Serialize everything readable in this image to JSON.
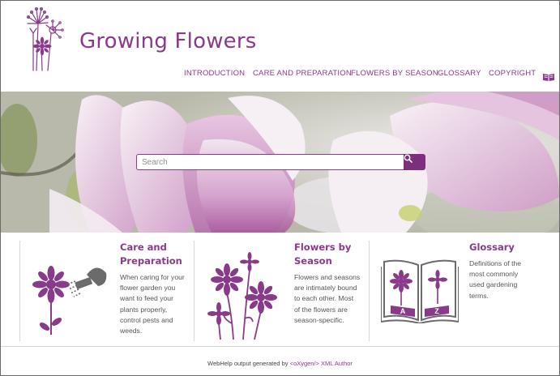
{
  "header": {
    "site_title": "Growing Flowers"
  },
  "nav": {
    "items": [
      {
        "label": "INTRODUCTION"
      },
      {
        "label": "CARE AND PREPARATION"
      },
      {
        "label": "FLOWERS BY SEASON"
      },
      {
        "label": "GLOSSARY"
      },
      {
        "label": "COPYRIGHT"
      }
    ],
    "extra_icon": "book-icon"
  },
  "search": {
    "placeholder": "Search",
    "button_icon": "search-icon"
  },
  "tiles": [
    {
      "title_line1": "Care and",
      "title_line2": "Preparation",
      "text_lines": [
        "When caring for your",
        "flower garden you",
        "want to feed your",
        "plants properly,",
        "control pests and",
        "weeds."
      ],
      "icon": "watering-flower-icon"
    },
    {
      "title_line1": "Flowers by",
      "title_line2": "Season",
      "text_lines": [
        "Flowers and seasons",
        "are intimately bound",
        "to each other. Most",
        "of the flowers are",
        "season-specific."
      ],
      "icon": "flowers-bunch-icon"
    },
    {
      "title_line1": "Glossary",
      "title_line2": "",
      "text_lines": [
        "Definitions of the",
        "most commonly",
        "used gardening",
        "terms."
      ],
      "icon": "glossary-book-icon",
      "book_letters": [
        "A",
        "Z"
      ]
    }
  ],
  "footer": {
    "prefix": "WebHelp output generated by ",
    "link": "<oXygen/> XML Author"
  },
  "colors": {
    "brand": "#8a3a8a",
    "button": "#7d2f7d"
  }
}
